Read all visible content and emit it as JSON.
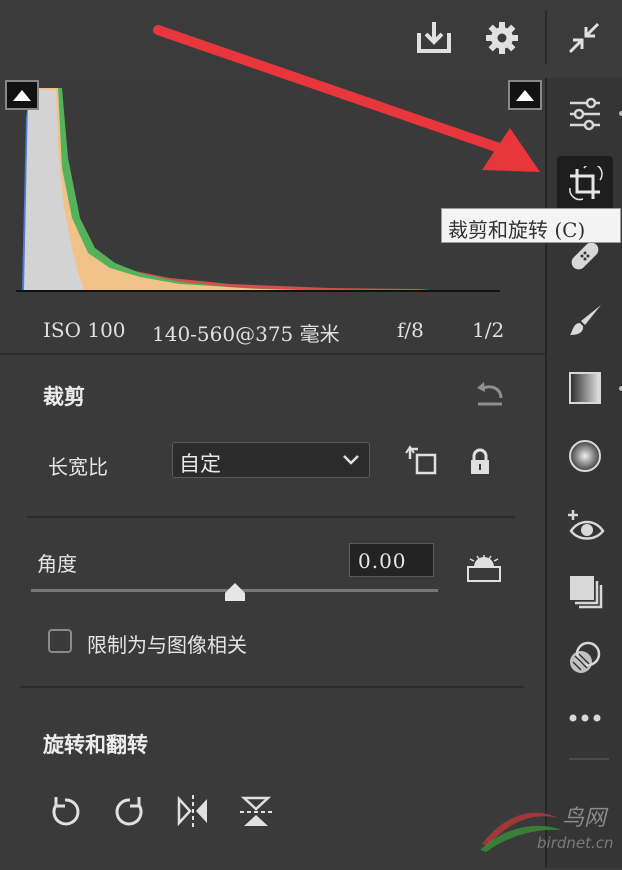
{
  "histogram_meta": {
    "iso": "ISO 100",
    "lens": "140-560@375 毫米",
    "aperture": "f/8",
    "shutter": "1/2"
  },
  "crop_panel": {
    "title": "裁剪",
    "aspect_label": "长宽比",
    "aspect_value": "自定",
    "angle_label": "角度",
    "angle_value": "0.00",
    "constrain_label": "限制为与图像相关"
  },
  "rotate_panel": {
    "title": "旋转和翻转"
  },
  "tooltip": {
    "text": "裁剪和旋转 (C)"
  },
  "watermark": {
    "text": "鸟网",
    "sub": "birdnet.cn"
  },
  "colors": {
    "background": "#3a3a3a",
    "annotation_arrow": "#e8373c",
    "tooltip_bg": "#f4f4f4"
  },
  "icons": {
    "top": [
      "download-icon",
      "gear-icon",
      "collapse-icon"
    ],
    "rail": [
      "edit-sliders-icon",
      "crop-rotate-icon",
      "healing-icon",
      "brush-icon",
      "linear-gradient-icon",
      "radial-gradient-icon",
      "red-eye-icon",
      "presets-icon",
      "snapshots-icon",
      "more-icon"
    ]
  }
}
